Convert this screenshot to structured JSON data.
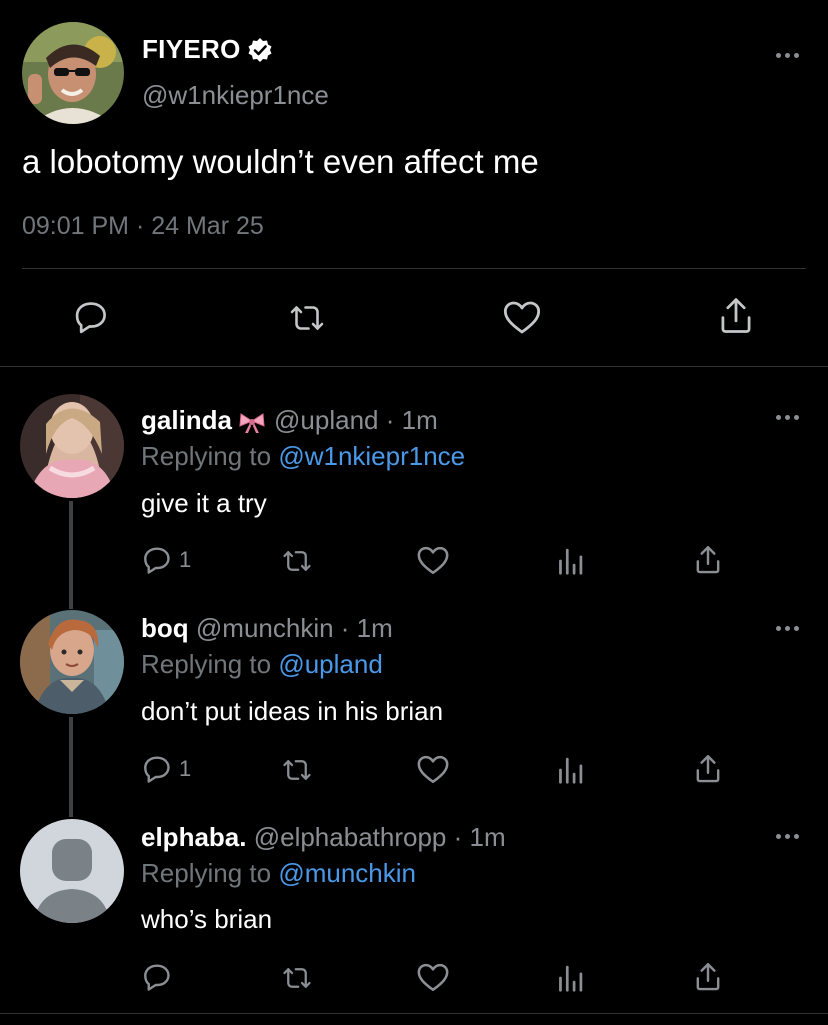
{
  "main_tweet": {
    "author_name": "FIYERO",
    "verified": true,
    "handle": "@w1nkiepr1nce",
    "text": "a lobotomy wouldn’t even affect me",
    "timestamp": "09:01 PM · 24 Mar 25",
    "actions": [
      "reply-icon",
      "retweet-icon",
      "like-icon",
      "share-icon"
    ]
  },
  "replies": [
    {
      "name": "galinda",
      "emoji": "🎀",
      "handle": "@upland",
      "time": "1m",
      "replying_label": "Replying to",
      "replying_to": "@w1nkiepr1nce",
      "text": "give it a try",
      "reply_count": "1"
    },
    {
      "name": "boq",
      "handle": "@munchkin",
      "time": "1m",
      "replying_label": "Replying to",
      "replying_to": "@upland",
      "text": "don’t put ideas in his brian",
      "reply_count": "1"
    },
    {
      "name": "elphaba.",
      "handle": "@elphabathropp",
      "time": "1m",
      "replying_label": "Replying to",
      "replying_to": "@munchkin",
      "text": "who’s brian",
      "reply_count": ""
    }
  ],
  "colors": {
    "background": "#000000",
    "primary_text": "#ffffff",
    "secondary_text": "#8b8f94",
    "link": "#4a99e9",
    "divider": "#2f3336"
  }
}
